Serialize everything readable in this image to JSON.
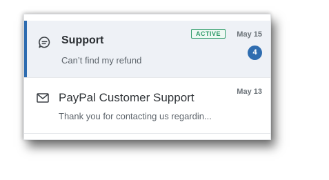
{
  "conversations": [
    {
      "title": "Support",
      "preview": "Can’t find my refund",
      "status": "ACTIVE",
      "date": "May 15",
      "unread_count": "4",
      "icon": "chat-bubble-icon"
    },
    {
      "title": "PayPal Customer Support",
      "preview": "Thank you for contacting us regardin...",
      "date": "May 13",
      "icon": "envelope-icon"
    }
  ],
  "colors": {
    "accent": "#2e6cb0",
    "active_badge": "#2f9b6a",
    "selected_background": "#eef1f6"
  }
}
